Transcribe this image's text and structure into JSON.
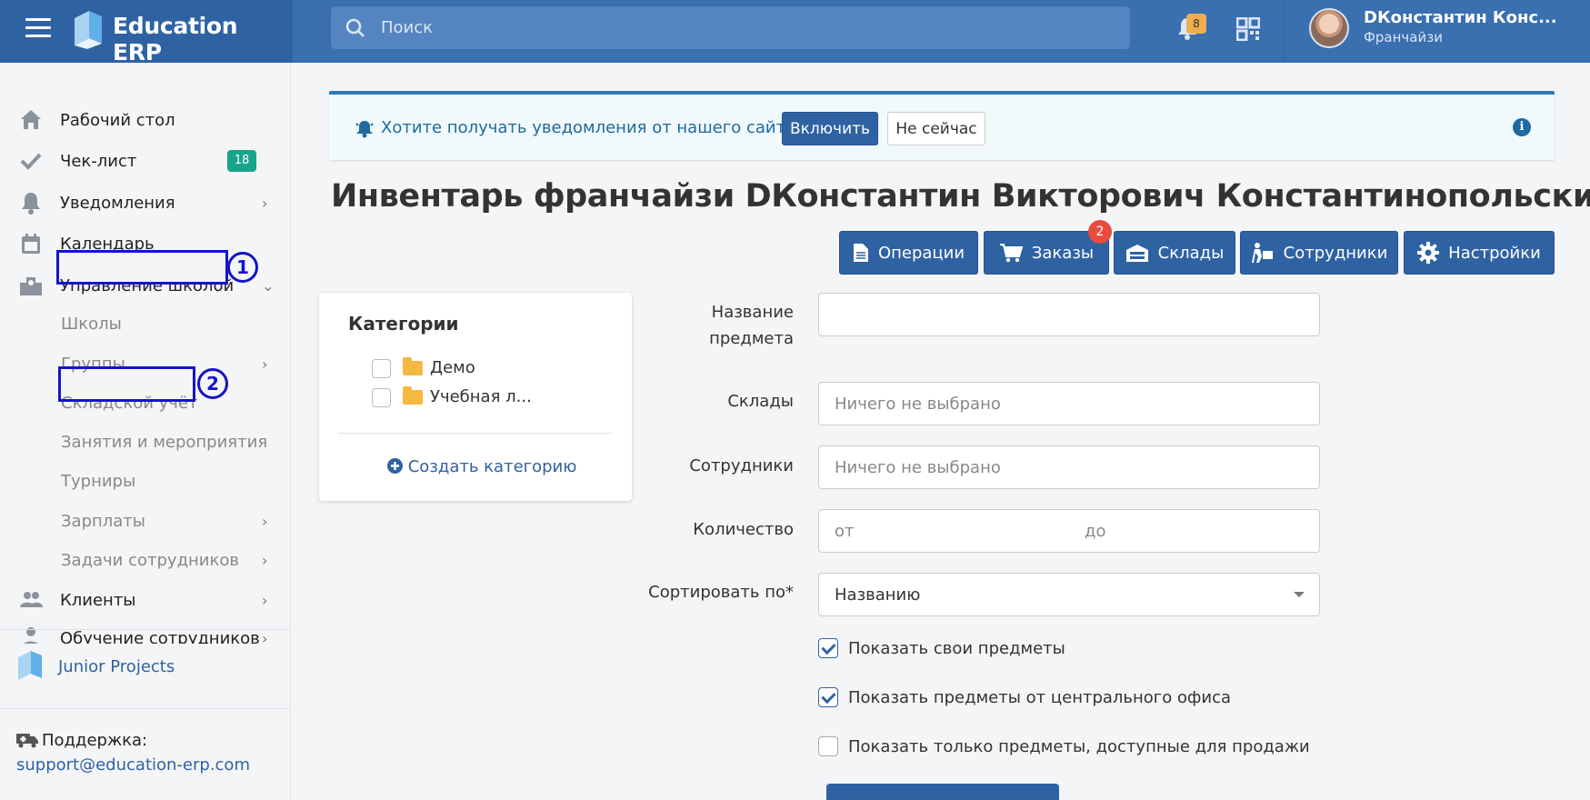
{
  "header": {
    "brand": "Education ERP",
    "search_placeholder": "Поиск",
    "notifications_count": "8",
    "user_name": "DКонстантин Конс...",
    "user_role": "Франчайзи"
  },
  "sidebar": {
    "items": [
      {
        "label": "Рабочий стол"
      },
      {
        "label": "Чек-лист",
        "badge": "18"
      },
      {
        "label": "Уведомления"
      },
      {
        "label": "Календарь"
      },
      {
        "label": "Управление школой"
      }
    ],
    "subitems": [
      {
        "label": "Школы"
      },
      {
        "label": "Группы"
      },
      {
        "label": "Складской учёт"
      },
      {
        "label": "Занятия и мероприятия"
      },
      {
        "label": "Турниры"
      },
      {
        "label": "Зарплаты"
      },
      {
        "label": "Задачи сотрудников"
      }
    ],
    "bottom_items": [
      {
        "label": "Клиенты"
      },
      {
        "label": "Обучение сотрудников"
      }
    ],
    "annotations": [
      "1",
      "2"
    ],
    "org_name": "Junior Projects",
    "support_label": "Поддержка:",
    "support_email": "support@education-erp.com"
  },
  "notice": {
    "text": "Хотите получать уведомления от нашего сайта?",
    "enable": "Включить",
    "later": "Не сейчас"
  },
  "page": {
    "title": "Инвентарь франчайзи DКонстантин Викторович Константинопольский"
  },
  "toolbar": {
    "operations": "Операции",
    "orders": "Заказы",
    "orders_badge": "2",
    "warehouses": "Склады",
    "employees": "Сотрудники",
    "settings": "Настройки"
  },
  "categories": {
    "title": "Категории",
    "items": [
      {
        "label": "Демо"
      },
      {
        "label": "Учебная л..."
      }
    ],
    "create": "Создать категорию"
  },
  "filters": {
    "item_name_label_1": "Название",
    "item_name_label_2": "предмета",
    "item_name_value": "",
    "warehouses_label": "Склады",
    "warehouses_placeholder": "Ничего не выбрано",
    "employees_label": "Сотрудники",
    "employees_placeholder": "Ничего не выбрано",
    "quantity_label": "Количество",
    "quantity_from": "от",
    "quantity_to": "до",
    "sort_label": "Сортировать по*",
    "sort_value": "Названию",
    "show_own": "Показать свои предметы",
    "show_own_checked": true,
    "show_central": "Показать предметы от центрального офиса",
    "show_central_checked": true,
    "show_for_sale": "Показать только предметы, доступные для продажи",
    "show_for_sale_checked": false
  }
}
